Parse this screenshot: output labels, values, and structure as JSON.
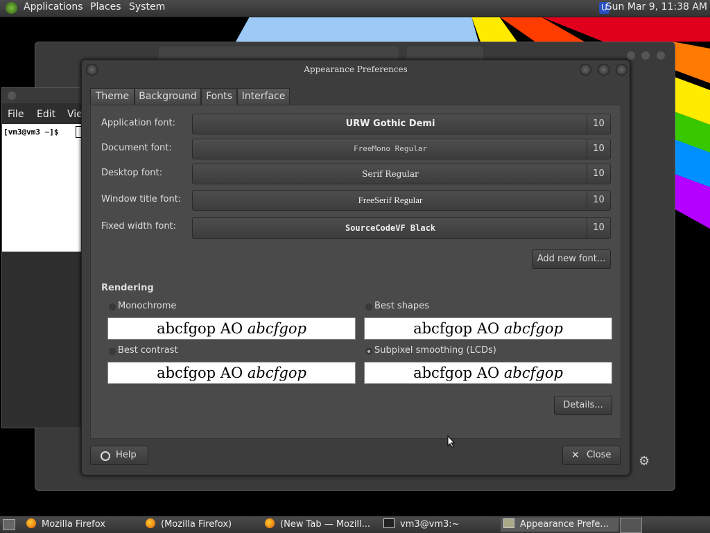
{
  "top_panel": {
    "menus": [
      "Applications",
      "Places",
      "System"
    ],
    "clock": "Sun Mar  9, 11:38 AM"
  },
  "terminal": {
    "menus": [
      "File",
      "Edit",
      "Vie"
    ],
    "prompt": "[vm3@vm3 ~]$"
  },
  "dialog": {
    "title": "Appearance Preferences",
    "tabs": [
      "Theme",
      "Background",
      "Fonts",
      "Interface"
    ],
    "active_tab": "Fonts",
    "fonts": [
      {
        "label": "Application font:",
        "name": "URW Gothic Demi",
        "size": "10"
      },
      {
        "label": "Document font:",
        "name": "FreeMono Regular",
        "size": "10"
      },
      {
        "label": "Desktop font:",
        "name": "Serif Regular",
        "size": "10"
      },
      {
        "label": "Window title font:",
        "name": "FreeSerif Regular",
        "size": "10"
      },
      {
        "label": "Fixed width font:",
        "name": "SourceCodeVF Black",
        "size": "10"
      }
    ],
    "add_font_label": "Add new font...",
    "rendering_heading": "Rendering",
    "rendering_options": [
      {
        "label": "Monochrome",
        "selected": false
      },
      {
        "label": "Best shapes",
        "selected": false
      },
      {
        "label": "Best contrast",
        "selected": false
      },
      {
        "label": "Subpixel smoothing (LCDs)",
        "selected": true
      }
    ],
    "preview_text": "abcfgop AO",
    "preview_italic": "abcfgop",
    "details_label": "Details...",
    "help_label": "Help",
    "close_label": "Close"
  },
  "taskbar": {
    "items": [
      {
        "label": "Mozilla Firefox",
        "icon": "firefox-icon"
      },
      {
        "label": "(Mozilla Firefox)",
        "icon": "firefox-icon"
      },
      {
        "label": "(New Tab — Mozill...",
        "icon": "firefox-icon"
      },
      {
        "label": "vm3@vm3:~",
        "icon": "terminal-icon"
      },
      {
        "label": "Appearance Prefe...",
        "icon": "appearance-icon"
      }
    ]
  }
}
